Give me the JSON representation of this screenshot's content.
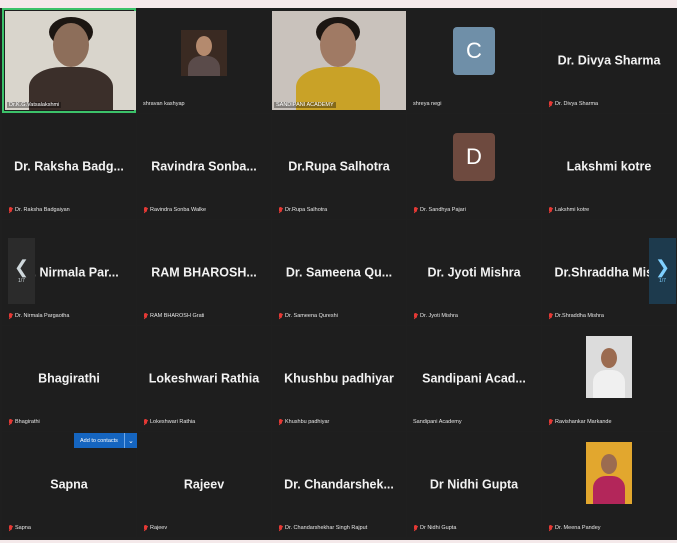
{
  "tiles": [
    {
      "name": "",
      "caption": "Dr.K.G.Vatsalakshmi",
      "kind": "video",
      "active": true,
      "muted": false
    },
    {
      "name": "",
      "caption": "shravan kashyap",
      "kind": "photo",
      "muted": false
    },
    {
      "name": "",
      "caption": "SANDIPANI ACADEMY",
      "kind": "video2",
      "muted": false
    },
    {
      "name": "",
      "caption": "shreya negi",
      "kind": "letter",
      "letter": "C",
      "letter_color": "#6f8fa8",
      "muted": false
    },
    {
      "name": "Dr. Divya Sharma",
      "caption": "Dr. Divya Sharma",
      "kind": "name",
      "muted": true
    },
    {
      "name": "Dr. Raksha Badg...",
      "caption": "Dr. Raksha Badgaiyan",
      "kind": "name",
      "muted": true
    },
    {
      "name": "Ravindra Sonba...",
      "caption": "Ravindra Sonba Walke",
      "kind": "name",
      "muted": true
    },
    {
      "name": "Dr.Rupa Salhotra",
      "caption": "Dr.Rupa Salhotra",
      "kind": "name",
      "muted": true
    },
    {
      "name": "",
      "caption": "Dr. Sandhya Pajari",
      "kind": "letter",
      "letter": "D",
      "letter_color": "#6e4a3f",
      "muted": true
    },
    {
      "name": "Lakshmi kotre",
      "caption": "Lakshmi kotre",
      "kind": "name",
      "muted": true
    },
    {
      "name": "Dr. Nirmala Par...",
      "caption": "Dr. Nirmala Pargaotha",
      "kind": "name",
      "muted": true
    },
    {
      "name": "RAM BHAROSH...",
      "caption": "RAM BHAROSH Grati",
      "kind": "name",
      "muted": true
    },
    {
      "name": "Dr. Sameena Qu...",
      "caption": "Dr. Sameena Qureshi",
      "kind": "name",
      "muted": true
    },
    {
      "name": "Dr. Jyoti Mishra",
      "caption": "Dr. Jyoti Mishra",
      "kind": "name",
      "muted": true
    },
    {
      "name": "Dr.Shraddha Mis...",
      "caption": "Dr.Shraddha Mishra",
      "kind": "name",
      "muted": true
    },
    {
      "name": "Bhagirathi",
      "caption": "Bhagirathi",
      "kind": "name",
      "muted": true
    },
    {
      "name": "Lokeshwari Rathia",
      "caption": "Lokeshwari Rathia",
      "kind": "name",
      "muted": true
    },
    {
      "name": "Khushbu padhiyar",
      "caption": "Khushbu padhiyar",
      "kind": "name",
      "muted": true
    },
    {
      "name": "Sandipani Acad...",
      "caption": "Sandipani Academy",
      "kind": "name",
      "muted": false
    },
    {
      "name": "",
      "caption": "Ravishankar Markande",
      "kind": "photo2",
      "muted": true
    },
    {
      "name": "Sapna",
      "caption": "Sapna",
      "kind": "name",
      "muted": true
    },
    {
      "name": "Rajeev",
      "caption": "Rajeev",
      "kind": "name",
      "muted": true
    },
    {
      "name": "Dr. Chandarshek...",
      "caption": "Dr. Chandarshekhar Singh Rajput",
      "kind": "name",
      "muted": true
    },
    {
      "name": "Dr Nidhi Gupta",
      "caption": "Dr Nidhi Gupta",
      "kind": "name",
      "muted": true
    },
    {
      "name": "",
      "caption": "Dr. Meena Pandey",
      "kind": "photo3",
      "muted": true
    }
  ],
  "nav": {
    "left_arrow": "❮",
    "right_arrow": "❯",
    "left_page": "1/7",
    "right_page": "1/7"
  },
  "tooltip": {
    "text": "Add to contacts",
    "chevron": "⌄"
  }
}
